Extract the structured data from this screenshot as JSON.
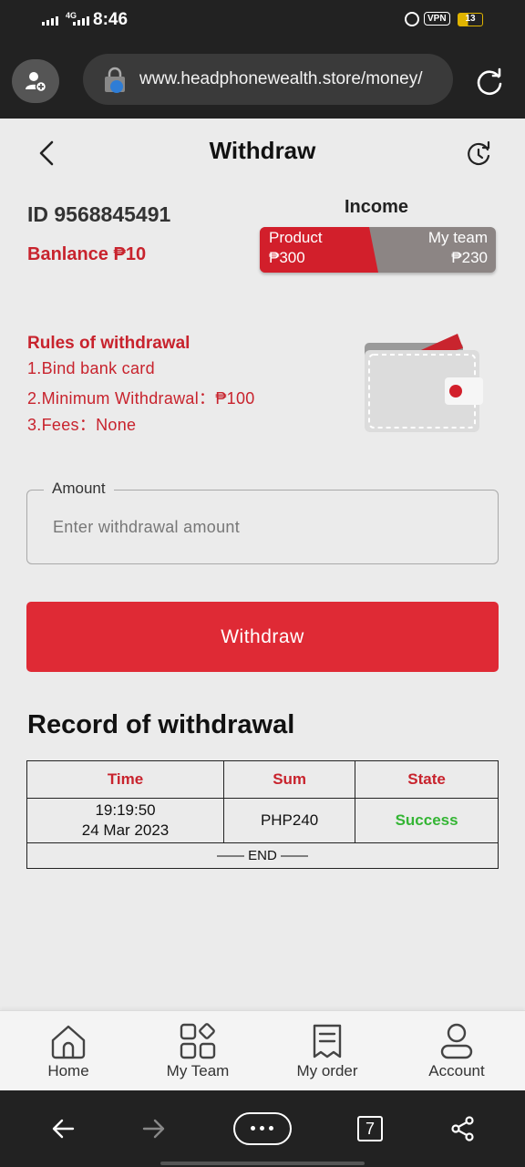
{
  "status_bar": {
    "time": "8:46",
    "network": "4G",
    "vpn": "VPN",
    "battery": "13"
  },
  "browser": {
    "url": "www.headphonewealth.store/money/",
    "tab_count": "7"
  },
  "header": {
    "title": "Withdraw"
  },
  "account": {
    "id_text": "ID 9568845491",
    "balance_text": "Banlance ₱10"
  },
  "income": {
    "label": "Income",
    "product_label": "Product",
    "product_value": "₱300",
    "team_label": "My team",
    "team_value": "₱230"
  },
  "rules": {
    "title": "Rules of withdrawal",
    "items": [
      "1.Bind bank card",
      "2.Minimum Withdrawal：₱100",
      "3.Fees：None"
    ]
  },
  "amount": {
    "label": "Amount",
    "placeholder": "Enter withdrawal amount",
    "value": ""
  },
  "withdraw_button": "Withdraw",
  "records": {
    "title": "Record of withdrawal",
    "columns": [
      "Time",
      "Sum",
      "State"
    ],
    "rows": [
      {
        "time_line1": "19:19:50",
        "time_line2": "24 Mar 2023",
        "sum": "PHP240",
        "state": "Success"
      }
    ],
    "end_text": "—— END ——"
  },
  "bottom_nav": [
    {
      "label": "Home",
      "icon": "home-icon"
    },
    {
      "label": "My Team",
      "icon": "team-grid-icon"
    },
    {
      "label": "My order",
      "icon": "order-icon"
    },
    {
      "label": "Account",
      "icon": "account-icon"
    }
  ],
  "colors": {
    "accent_red": "#df2a35",
    "text_red": "#c8232d",
    "success_green": "#34b534",
    "income_grey": "#8c8584"
  }
}
